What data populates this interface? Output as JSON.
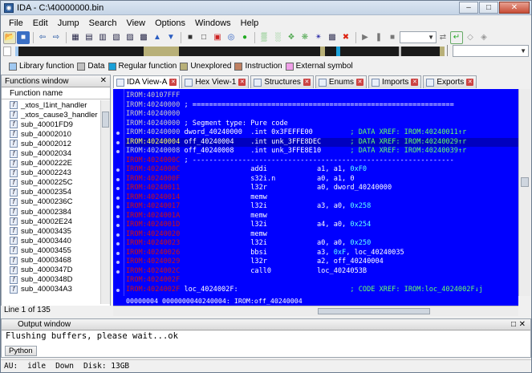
{
  "window": {
    "title": "IDA - C:\\40000000.bin"
  },
  "menu": [
    "File",
    "Edit",
    "Jump",
    "Search",
    "View",
    "Options",
    "Windows",
    "Help"
  ],
  "legend": [
    {
      "label": "Library function",
      "color": "#a0c8f0"
    },
    {
      "label": "Data",
      "color": "#c0c0c0"
    },
    {
      "label": "Regular function",
      "color": "#1aa0d8"
    },
    {
      "label": "Unexplored",
      "color": "#b8b078"
    },
    {
      "label": "Instruction",
      "color": "#c08060"
    },
    {
      "label": "External symbol",
      "color": "#f0a0e8"
    }
  ],
  "functions_panel": {
    "title": "Functions window",
    "column": "Function name",
    "items": [
      "_xtos_l1int_handler",
      "_xtos_cause3_handler",
      "sub_40001FD9",
      "sub_40002010",
      "sub_40002012",
      "sub_40002034",
      "sub_4000222E",
      "sub_40002243",
      "sub_4000225C",
      "sub_40002354",
      "sub_4000236C",
      "sub_40002384",
      "sub_40002E24",
      "sub_40003435",
      "sub_40003440",
      "sub_40003455",
      "sub_40003468",
      "sub_4000347D",
      "sub_4000348D",
      "sub_400034A3"
    ],
    "line_count": "Line 1 of 135"
  },
  "tabs": [
    {
      "label": "IDA View-A",
      "active": true
    },
    {
      "label": "Hex View-1",
      "active": false
    },
    {
      "label": "Structures",
      "active": false
    },
    {
      "label": "Enums",
      "active": false
    },
    {
      "label": "Imports",
      "active": false
    },
    {
      "label": "Exports",
      "active": false
    }
  ],
  "disasm": [
    {
      "addr": "IROM:40107FFF",
      "text": "",
      "ac": "g",
      "tc": "w"
    },
    {
      "addr": "IROM:40240000",
      "text": " ; ===============================================================",
      "ac": "g",
      "tc": "w"
    },
    {
      "addr": "IROM:40240000",
      "text": "",
      "ac": "g",
      "tc": "w"
    },
    {
      "addr": "IROM:40240000",
      "text": " ; Segment type: Pure code",
      "ac": "g",
      "tc": "w"
    },
    {
      "addr": "IROM:40240000",
      "text": " dword_40240000  .int 0x3FEFFE00         ",
      "xref": "; DATA XREF: IROM:40240011↑r",
      "ac": "g",
      "tc": "w"
    },
    {
      "addr": "IROM:40240004",
      "text": " off_40240004    .int unk_3FFE8DEC       ",
      "xref": "; DATA XREF: IROM:40240029↑r",
      "ac": "y",
      "tc": "w"
    },
    {
      "addr": "IROM:40240008",
      "text": " off_40240008    .int unk_3FFE8E10       ",
      "xref": "; DATA XREF: IROM:40240039↑r",
      "ac": "g",
      "tc": "w"
    },
    {
      "addr": "IROM:4024000C",
      "text": " ; ---------------------------------------------------------------",
      "ac": "r",
      "tc": "w"
    },
    {
      "addr": "IROM:4024000C",
      "text": "                 addi            a1, a1, ",
      "num": "0xF0",
      "ac": "r",
      "tc": "w"
    },
    {
      "addr": "IROM:4024000F",
      "text": "                 s32i.n          a0, a1, 0",
      "ac": "r",
      "tc": "w"
    },
    {
      "addr": "IROM:40240011",
      "text": "                 l32r            a0, dword_40240000",
      "ac": "r",
      "tc": "w"
    },
    {
      "addr": "IROM:40240014",
      "text": "                 memw",
      "ac": "r",
      "tc": "w"
    },
    {
      "addr": "IROM:40240017",
      "text": "                 l32i            a3, a0, ",
      "num": "0x258",
      "ac": "r",
      "tc": "w"
    },
    {
      "addr": "IROM:4024001A",
      "text": "                 memw",
      "ac": "r",
      "tc": "w"
    },
    {
      "addr": "IROM:4024001D",
      "text": "                 l32i            a4, a0, ",
      "num": "0x254",
      "ac": "r",
      "tc": "w"
    },
    {
      "addr": "IROM:40240020",
      "text": "                 memw",
      "ac": "r",
      "tc": "w"
    },
    {
      "addr": "IROM:40240023",
      "text": "                 l32i            a0, a0, ",
      "num": "0x250",
      "ac": "r",
      "tc": "w"
    },
    {
      "addr": "IROM:40240026",
      "text": "                 bbsi            a3, ",
      "num": "0xF",
      "tail": ", loc_40240035",
      "ac": "r",
      "tc": "w"
    },
    {
      "addr": "IROM:40240029",
      "text": "                 l32r            a2, off_40240004",
      "ac": "r",
      "tc": "w"
    },
    {
      "addr": "IROM:4024002C",
      "text": "                 call0           loc_4024053B",
      "ac": "r",
      "tc": "w"
    },
    {
      "addr": "IROM:4024002F",
      "text": "",
      "ac": "r",
      "tc": "w"
    },
    {
      "addr": "IROM:4024002F",
      "text": " loc_4024002F:                           ",
      "xref": "; CODE XREF: IROM:loc_4024002F↓j",
      "ac": "r",
      "tc": "w"
    }
  ],
  "disasm_status": "00000004 0000000040240004: IROM:off_40240004",
  "output": {
    "title": "Output window",
    "text": "Flushing buffers, please wait...ok",
    "button": "Python"
  },
  "status": {
    "au": "AU:",
    "state": "idle",
    "dir": "Down",
    "disk": "Disk: 13GB"
  }
}
